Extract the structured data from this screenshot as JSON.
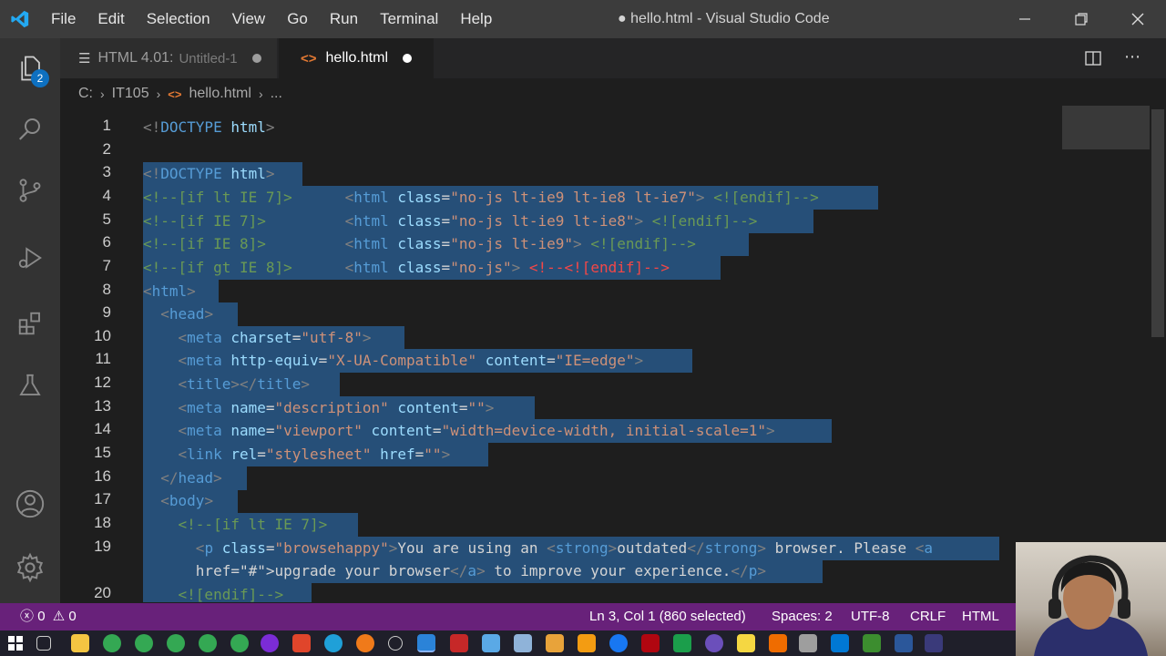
{
  "window": {
    "title": "● hello.html - Visual Studio Code",
    "menu": [
      "File",
      "Edit",
      "Selection",
      "View",
      "Go",
      "Run",
      "Terminal",
      "Help"
    ]
  },
  "activity_bar": {
    "explorer_badge": "2",
    "icons": [
      "files-icon",
      "search-icon",
      "source-control-icon",
      "run-debug-icon",
      "extensions-icon",
      "testing-icon",
      "account-icon",
      "settings-gear-icon"
    ]
  },
  "tabs": [
    {
      "label": "HTML 4.01:",
      "description": "Untitled-1",
      "active": false,
      "dirty": true
    },
    {
      "label": "hello.html",
      "active": true,
      "dirty": true
    }
  ],
  "breadcrumb": {
    "drive": "C:",
    "folder": "IT105",
    "file": "hello.html",
    "more": "..."
  },
  "editor": {
    "lines": [
      {
        "n": "1"
      },
      {
        "n": "2"
      },
      {
        "n": "3"
      },
      {
        "n": "4"
      },
      {
        "n": "5"
      },
      {
        "n": "6"
      },
      {
        "n": "7"
      },
      {
        "n": "8"
      },
      {
        "n": "9"
      },
      {
        "n": "10"
      },
      {
        "n": "11"
      },
      {
        "n": "12"
      },
      {
        "n": "13"
      },
      {
        "n": "14"
      },
      {
        "n": "15"
      },
      {
        "n": "16"
      },
      {
        "n": "17"
      },
      {
        "n": "18"
      },
      {
        "n": "19"
      },
      {
        "n": "20"
      }
    ],
    "code": [
      "<!DOCTYPE html>",
      "",
      "<!DOCTYPE html>",
      "<!--[if lt IE 7]>      <html class=\"no-js lt-ie9 lt-ie8 lt-ie7\"> <![endif]-->",
      "<!--[if IE 7]>         <html class=\"no-js lt-ie9 lt-ie8\"> <![endif]-->",
      "<!--[if IE 8]>         <html class=\"no-js lt-ie9\"> <![endif]-->",
      "<!--[if gt IE 8]>      <html class=\"no-js\"> <!--<![endif]-->",
      "<html>",
      "  <head>",
      "    <meta charset=\"utf-8\">",
      "    <meta http-equiv=\"X-UA-Compatible\" content=\"IE=edge\">",
      "    <title></title>",
      "    <meta name=\"description\" content=\"\">",
      "    <meta name=\"viewport\" content=\"width=device-width, initial-scale=1\">",
      "    <link rel=\"stylesheet\" href=\"\">",
      "  </head>",
      "  <body>",
      "    <!--[if lt IE 7]>",
      "      <p class=\"browsehappy\">You are using an <strong>outdated</strong> browser. Please <a",
      "      href=\"#\">upgrade your browser</a> to improve your experience.</p>",
      "    <![endif]-->"
    ]
  },
  "status_bar": {
    "errors": "0",
    "warnings": "0",
    "position": "Ln 3, Col 1 (860 selected)",
    "indent": "Spaces: 2",
    "encoding": "UTF-8",
    "eol": "CRLF",
    "language": "HTML"
  },
  "colors": {
    "status_bar": "#68217a",
    "selection": "#264f78",
    "tag": "#569cd6",
    "attribute": "#9cdcfe",
    "string": "#ce9178",
    "comment": "#6a9955"
  }
}
